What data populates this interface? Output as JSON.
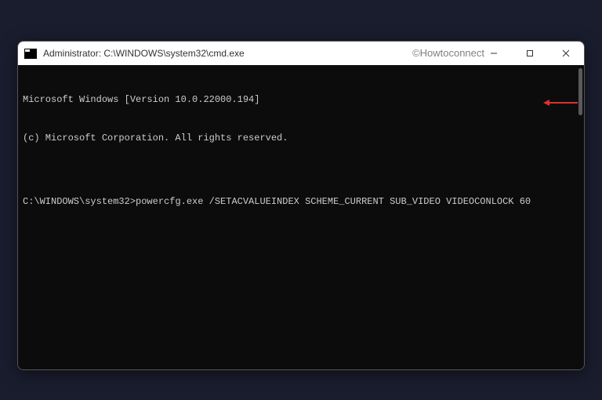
{
  "watermark": "©Howtoconnect",
  "window": {
    "title": "Administrator: C:\\WINDOWS\\system32\\cmd.exe"
  },
  "terminal": {
    "line1": "Microsoft Windows [Version 10.0.22000.194]",
    "line2": "(c) Microsoft Corporation. All rights reserved.",
    "blank": "",
    "prompt": "C:\\WINDOWS\\system32>",
    "command": "powercfg.exe /SETACVALUEINDEX SCHEME_CURRENT SUB_VIDEO VIDEOCONLOCK 60"
  }
}
